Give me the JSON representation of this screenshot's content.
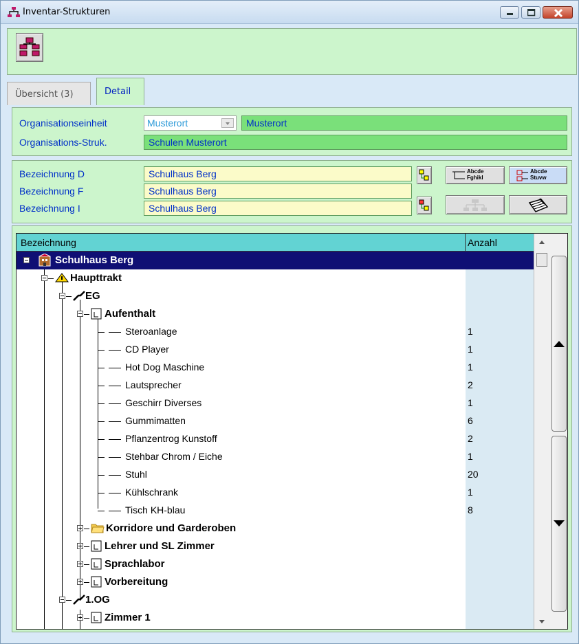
{
  "window": {
    "title": "Inventar-Strukturen"
  },
  "tabs": [
    {
      "label": "Übersicht (3)"
    },
    {
      "label": "Detail"
    }
  ],
  "org": {
    "unit_label": "Organisationseinheit",
    "unit_combo_value": "Musterort",
    "unit_value": "Musterort",
    "struct_label": "Organisations-Struk.",
    "struct_value": "Schulen Musterort"
  },
  "names": {
    "d_label": "Bezeichnung D",
    "d_value": "Schulhaus Berg",
    "f_label": "Bezeichnung F",
    "f_value": "Schulhaus Berg",
    "i_label": "Bezeichnung I",
    "i_value": "Schulhaus Berg"
  },
  "buttons": {
    "format1_text_top": "Abcde",
    "format1_text_bottom": "Fghikl",
    "format2_text_top": "Abcde",
    "format2_text_bottom": "Stuvw"
  },
  "tree": {
    "col_name": "Bezeichnung",
    "col_count": "Anzahl",
    "rows": [
      {
        "label": "Schulhaus Berg",
        "count": ""
      },
      {
        "label": "Haupttrakt",
        "count": ""
      },
      {
        "label": "EG",
        "count": ""
      },
      {
        "label": "Aufenthalt",
        "count": ""
      },
      {
        "label": "Steroanlage",
        "count": "1"
      },
      {
        "label": "CD Player",
        "count": "1"
      },
      {
        "label": "Hot Dog Maschine",
        "count": "1"
      },
      {
        "label": "Lautsprecher",
        "count": "2"
      },
      {
        "label": "Geschirr Diverses",
        "count": "1"
      },
      {
        "label": "Gummimatten",
        "count": "6"
      },
      {
        "label": "Pflanzentrog Kunstoff",
        "count": "2"
      },
      {
        "label": "Stehbar Chrom / Eiche",
        "count": "1"
      },
      {
        "label": "Stuhl",
        "count": "20"
      },
      {
        "label": "Kühlschrank",
        "count": "1"
      },
      {
        "label": "Tisch KH-blau",
        "count": "8"
      },
      {
        "label": "Korridore und Garderoben",
        "count": ""
      },
      {
        "label": "Lehrer und SL Zimmer",
        "count": ""
      },
      {
        "label": "Sprachlabor",
        "count": ""
      },
      {
        "label": "Vorbereitung",
        "count": ""
      },
      {
        "label": "1.OG",
        "count": ""
      },
      {
        "label": "Zimmer 1",
        "count": ""
      }
    ]
  },
  "colors": {
    "panel_green": "#ccf5cc",
    "field_green": "#7ae07a",
    "field_yellow": "#fbfbc9",
    "label_blue": "#0030c8",
    "header_teal": "#62d3d3",
    "selection_navy": "#0f0f74"
  },
  "icons": {
    "title": "org-chart-icon",
    "toolbar": "org-chart-icon",
    "root": "building-icon",
    "wing": "warning-tent-icon",
    "floor": "stairs-icon",
    "room": "room-icon",
    "corridor": "folder-icon"
  }
}
